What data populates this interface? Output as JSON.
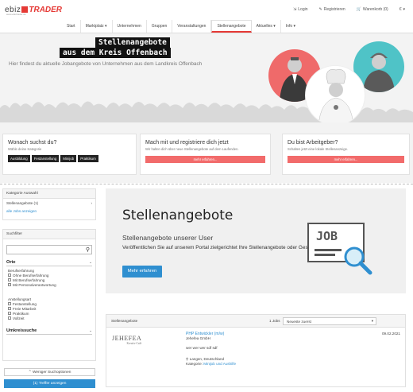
{
  "header": {
    "logo_text": "ebiz",
    "logo_accent": "TRADER",
    "logo_sub": "www.ebiztrader.de",
    "login": "Login",
    "register": "Registrieren",
    "cart": "Warenkorb (0)",
    "currency": "€"
  },
  "nav": [
    {
      "label": "Start"
    },
    {
      "label": "Marktplatz ▾"
    },
    {
      "label": "Unternehmen"
    },
    {
      "label": "Gruppen"
    },
    {
      "label": "Veranstaltungen"
    },
    {
      "label": "Stellenangebote",
      "active": true
    },
    {
      "label": "Aktuelles ▾"
    },
    {
      "label": "Info ▾"
    }
  ],
  "hero": {
    "title_line1": "Stellenangebote",
    "title_line2": "aus dem Kreis Offenbach",
    "subtitle": "Hier findest du aktuelle Jobangebote von Unternehmen aus dem Landkreis Offenbach"
  },
  "cards": {
    "search": {
      "title": "Wonach suchst du?",
      "text": "Wähle deine Kategorie",
      "buttons": [
        "Ausbildung",
        "Festanstellung",
        "Minijob",
        "Praktikum"
      ]
    },
    "register": {
      "title": "Mach mit und registriere dich jetzt",
      "text": "Wir halten dich über neue Stellenangebote auf dem Laufenden.",
      "button": "mehr erfahren..."
    },
    "employer": {
      "title": "Du bist Arbeitgeber?",
      "text": "Schalten jetzt eine lokale Stellenanzeige.",
      "button": "mehr erfahren..."
    }
  },
  "sidebar": {
    "category_head": "Kategorie Auswahl",
    "category_item": "Stellenangebote (1)",
    "all_jobs": "alle Jobs anzeigen",
    "filter_head": "Suchfilter",
    "ort_title": "Orte",
    "berufserfahrung_title": "Berufserfahrung",
    "berufserfahrung": [
      "Ohne Berufserfahrung",
      "Mit Berufserfahrung",
      "Mit Personalverantwortung"
    ],
    "anstellungsart_title": "Anstellungsart",
    "anstellungsart": [
      "Festanstellung",
      "Freie Mitarbeit",
      "Praktikum",
      "Vollzeit"
    ],
    "umkreis_title": "Umkreissuche",
    "less_options": "Weniger Suchoptionen",
    "show_results": "(1) Treffer anzeigen"
  },
  "promo": {
    "title": "Stellenangebote",
    "subtitle": "Stellenangebote unserer User",
    "text": "Veröffentlichen Sie auf unserem Portal zielgerichtet Ihre Stellenangebote oder Gesuche.",
    "button": "Mehr erfahren",
    "job_icon_text": "JOB"
  },
  "results": {
    "header_label": "Stellenangebote",
    "count": "1 Jobs",
    "sort": "Neueste zuerst",
    "items": [
      {
        "company_logo": "JEHEFEA",
        "company_logo_sub": "Kreativ-Café",
        "title": "PHP Entwickler (m/w)",
        "company": "Jehefea GmbH",
        "description": "wer wer wer sdf sdf",
        "location": "Langen, Deutschland",
        "category_label": "Kategorie:",
        "category": "Minijob und Aushilfe",
        "date": "09.02.2021"
      }
    ]
  },
  "colors": {
    "accent_red": "#e53935",
    "button_red": "#f26b6b",
    "button_blue": "#2f8fd0",
    "hero_teal": "#4fc3c7"
  }
}
